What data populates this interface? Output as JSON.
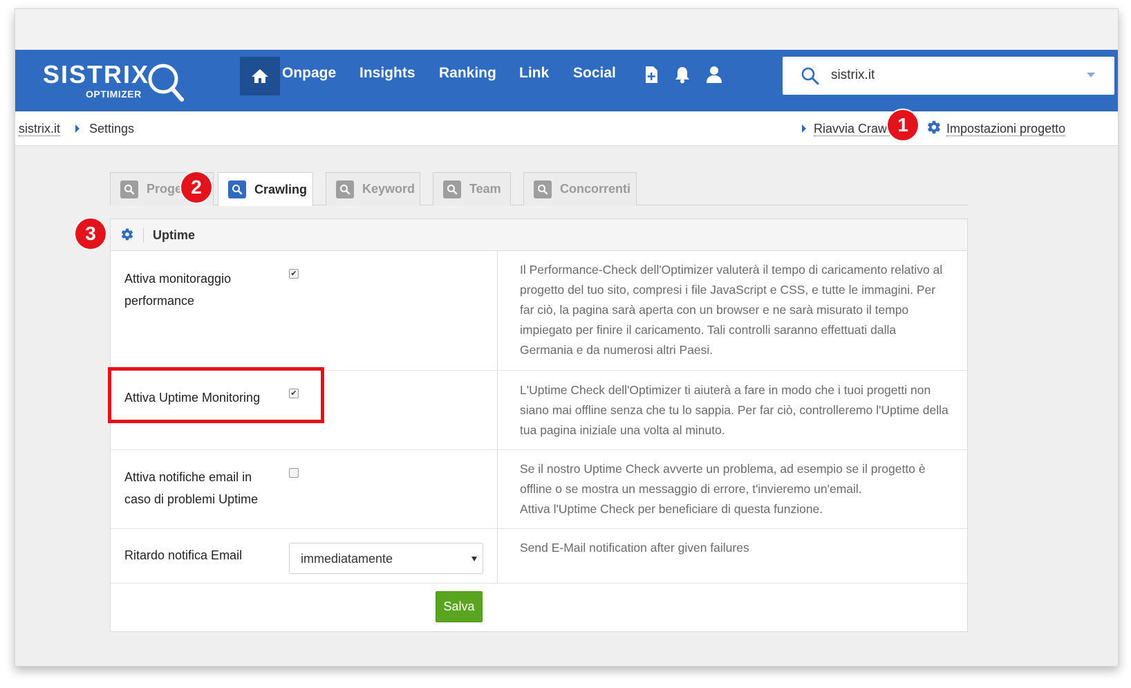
{
  "nav": {
    "logo_text": "SISTRIX",
    "logo_sub": "OPTIMIZER",
    "items": [
      {
        "label": "Onpage"
      },
      {
        "label": "Insights"
      },
      {
        "label": "Ranking"
      },
      {
        "label": "Link"
      },
      {
        "label": "Social"
      }
    ],
    "icons": [
      "home-icon",
      "add-file-icon",
      "bell-icon",
      "user-icon"
    ],
    "search": {
      "value": "sistrix.it"
    }
  },
  "subbar": {
    "breadcrumb_root": "sistrix.it",
    "breadcrumb_current": "Settings",
    "restart_crawler": "Riavvia Crawler",
    "project_settings": "Impostazioni progetto"
  },
  "markers": {
    "m1": "1",
    "m2": "2",
    "m3": "3"
  },
  "tabs": [
    {
      "label": "Progetto"
    },
    {
      "label": "Crawling",
      "active": true
    },
    {
      "label": "Keyword"
    },
    {
      "label": "Team"
    },
    {
      "label": "Concorrenti"
    }
  ],
  "panel": {
    "title": "Uptime",
    "rows": [
      {
        "label": "Attiva monitoraggio performance",
        "checked": true,
        "description": "Il Performance-Check dell'Optimizer valuterà il tempo di caricamento relativo al progetto del tuo sito, compresi i file JavaScript e CSS, e tutte le immagini. Per far ciò, la pagina sarà aperta con un browser e ne sarà misurato il tempo impiegato per finire il caricamento. Tali controlli saranno effettuati dalla Germania e da numerosi altri Paesi."
      },
      {
        "label": "Attiva Uptime Monitoring",
        "checked": true,
        "description": "L'Uptime Check dell'Optimizer ti aiuterà a fare in modo che i tuoi progetti non siano mai offline senza che tu lo sappia. Per far ciò, controlleremo l'Uptime della tua pagina iniziale una volta al minuto."
      },
      {
        "label": "Attiva notifiche email in caso di problemi Uptime",
        "checked": false,
        "description_lines": [
          "Se il nostro Uptime Check avverte un problema, ad esempio se il progetto è offline o se mostra un messaggio di errore, t'invieremo un'email.",
          "Attiva l'Uptime Check per beneficiare di questa funzione."
        ]
      },
      {
        "label": "Ritardo notifica Email",
        "select_value": "immediatamente",
        "description": "Send E-Mail notification after given failures"
      }
    ],
    "save_label": "Salva"
  },
  "colors": {
    "nav_blue": "#2f6bc1",
    "marker_red": "#e3131b",
    "save_green": "#5aa51f"
  }
}
